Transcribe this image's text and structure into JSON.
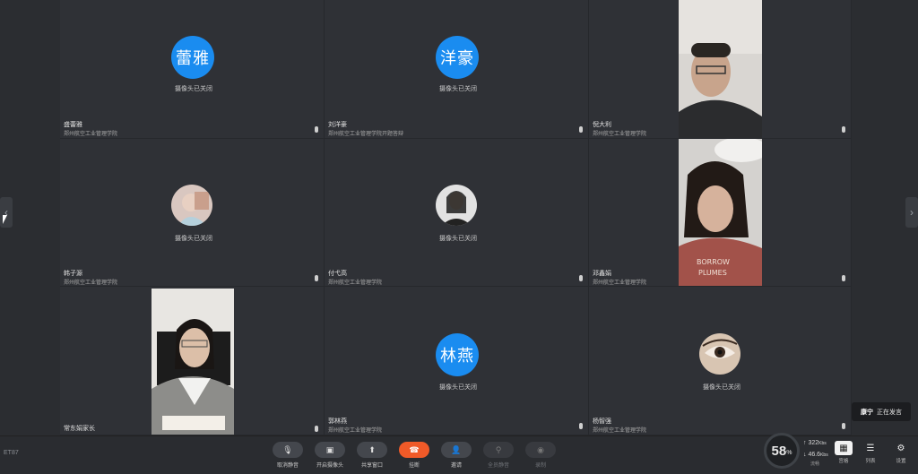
{
  "tiles": [
    {
      "name": "蕾雅",
      "avatar": "蕾雅",
      "full_name": "盛蕾雅",
      "org": "郑州航空工业管理学院",
      "status": "摄像头已关闭"
    },
    {
      "name": "洋豪",
      "avatar": "洋豪",
      "full_name": "刘洋豪",
      "org": "郑州航空工业管理学院开题答辩",
      "status": "摄像头已关闭"
    },
    {
      "full_name": "倪大利",
      "org": "郑州航空工业管理学院"
    },
    {
      "full_name": "韩子源",
      "org": "郑州航空工业管理学院",
      "status": "摄像头已关闭"
    },
    {
      "full_name": "付弋高",
      "org": "郑州航空工业管理学院",
      "status": "摄像头已关闭"
    },
    {
      "full_name": "邓鑫娟",
      "org": "郑州航空工业管理学院"
    },
    {
      "full_name": "常东娟家长"
    },
    {
      "name": "林燕",
      "avatar": "林燕",
      "full_name": "郭林燕",
      "org": "郑州航空工业管理学院",
      "status": "摄像头已关闭"
    },
    {
      "full_name": "杨智强",
      "org": "郑州航空工业管理学院",
      "status": "摄像头已关闭"
    }
  ],
  "toolbar": {
    "mute": "取消静音",
    "camera": "开启摄像头",
    "share": "共享窗口",
    "hangup": "挂断",
    "invite": "邀请",
    "all_mute": "全员静音",
    "record": "录制"
  },
  "logo": "ET87",
  "network": {
    "score": "58",
    "unit": "%",
    "up": "322",
    "up_unit": "Kbs",
    "down": "46.6",
    "down_unit": "Kbs",
    "label": "流畅"
  },
  "right_buttons": {
    "layout": "宫格",
    "list": "列表",
    "settings": "设置"
  },
  "toast": {
    "name": "康宁",
    "text": "正在发言"
  }
}
